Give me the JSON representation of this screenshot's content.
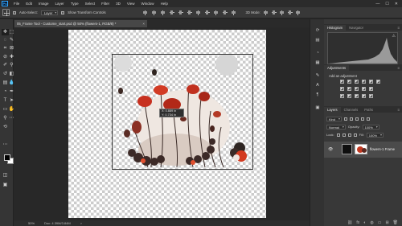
{
  "app": {
    "logo_text": "Ps"
  },
  "menu": [
    "File",
    "Edit",
    "Image",
    "Layer",
    "Type",
    "Select",
    "Filter",
    "3D",
    "View",
    "Window",
    "Help"
  ],
  "window_controls": [
    "—",
    "☐",
    "✕"
  ],
  "options": {
    "auto_select_label": "Auto-Select:",
    "auto_select_value": "Layer",
    "show_transform_label": "Show Transform Controls",
    "mode_3d_label": "3D Mode:"
  },
  "document": {
    "tab_title": "05_Frame Tool - Custome_start.psd @ 50% (flowers-1, RGB/8) *",
    "close_glyph": "×",
    "hud_text": "X: 0.889 in\nY: 0.734 in"
  },
  "status": {
    "zoom": "50%",
    "doc_size": "Doc: 4.39M/3.84M",
    "arrow": ">"
  },
  "panels": {
    "histogram_tabs": [
      "Histogram",
      "Navigator"
    ],
    "adjustments_tab": "Adjustments",
    "adjustments_hint": "Add an adjustment",
    "layers_tabs": [
      "Layers",
      "Channels",
      "Paths"
    ],
    "kind_label": "Kind",
    "blend_mode": "Normal",
    "opacity_label": "Opacity:",
    "opacity_value": "100%",
    "lock_label": "Lock:",
    "fill_label": "Fill:",
    "fill_value": "100%",
    "layer_name": "flowers-1 Frame",
    "menu_glyph": "≡",
    "histogram_warning": "⚠"
  },
  "footer_icons": [
    "⛓",
    "fx",
    "◐",
    "◍",
    "▭",
    "⊞",
    "🗑"
  ]
}
